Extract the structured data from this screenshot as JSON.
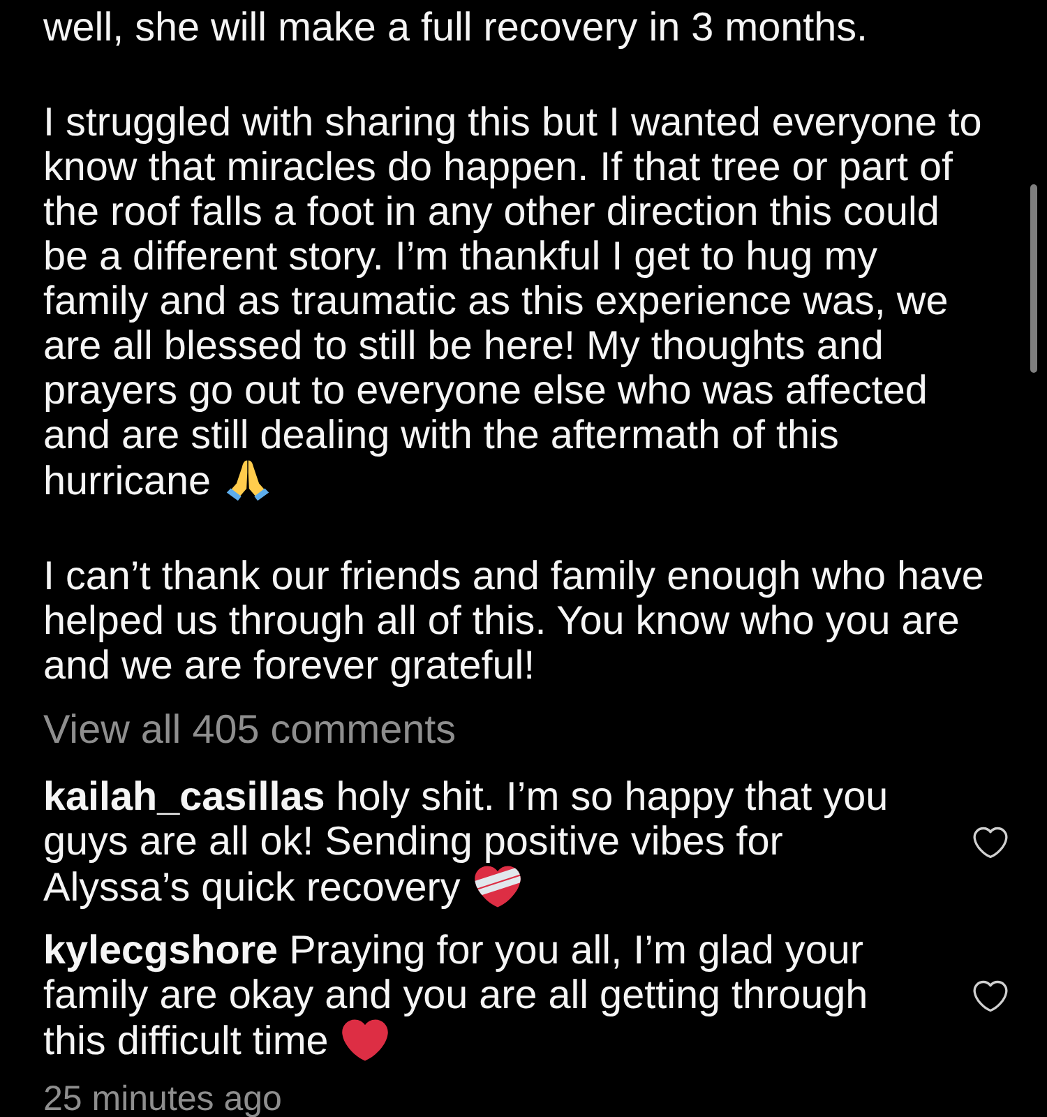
{
  "caption": {
    "paragraphs": [
      {
        "lines": [
          "well, she will make a full recovery in 3 months."
        ]
      },
      {
        "lines": [
          "I struggled with sharing this but I wanted everyone to",
          "know that miracles do happen. If that tree or part of",
          "the roof falls a foot in any other direction this could",
          "be a different story. I’m thankful I get to hug my",
          "family and as traumatic as this experience was, we",
          "are all blessed to still be here! My thoughts and",
          "prayers go out to everyone else who was affected",
          "and are still dealing with the aftermath of this",
          "hurricane"
        ],
        "emoji": {
          "kind": "pray"
        }
      },
      {
        "lines": [
          "I can’t thank our friends and family enough who have",
          "helped us through all of this. You know who you are",
          "and we are forever grateful!"
        ]
      }
    ]
  },
  "view_all_comments": "View all 405 comments",
  "comments": [
    {
      "username": "kailah_casillas",
      "lines": [
        "holy shit. I’m so happy that you",
        "guys are all ok! Sending positive vibes for",
        "Alyssa’s quick recovery"
      ],
      "emoji": {
        "kind": "mending"
      },
      "liked": false
    },
    {
      "username": "kylecgshore",
      "lines": [
        "Praying for you all, I’m glad your",
        "family are okay and you are all getting through",
        "this difficult time"
      ],
      "emoji": {
        "kind": "heart"
      },
      "liked": false
    }
  ],
  "timestamp": "25 minutes ago"
}
